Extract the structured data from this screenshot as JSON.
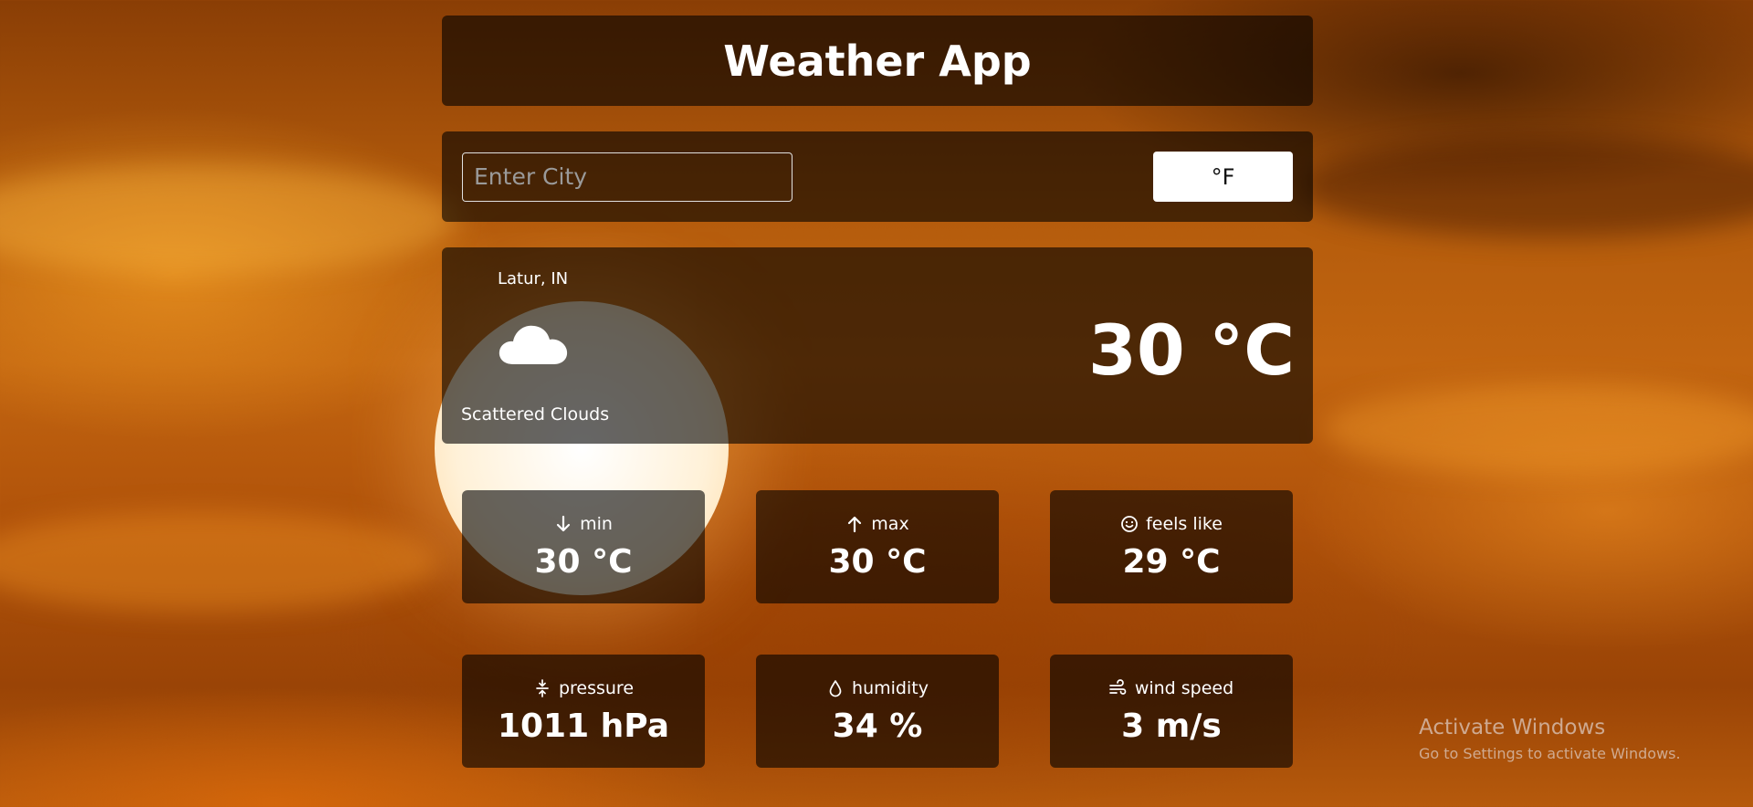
{
  "header": {
    "title": "Weather App"
  },
  "search": {
    "placeholder": "Enter City",
    "value": "",
    "unit_button_label": "°F"
  },
  "current": {
    "location": "Latur, IN",
    "icon": "cloud-icon",
    "description": "Scattered Clouds",
    "temperature": "30 °C"
  },
  "stats": [
    {
      "label": "min",
      "value": "30 °C",
      "icon": "arrow-down-icon"
    },
    {
      "label": "max",
      "value": "30 °C",
      "icon": "arrow-up-icon"
    },
    {
      "label": "feels like",
      "value": "29 °C",
      "icon": "smiley-icon"
    },
    {
      "label": "pressure",
      "value": "1011 hPa",
      "icon": "compress-icon"
    },
    {
      "label": "humidity",
      "value": "34 %",
      "icon": "droplet-icon"
    },
    {
      "label": "wind speed",
      "value": "3 m/s",
      "icon": "wind-icon"
    }
  ],
  "watermark": {
    "title": "Activate Windows",
    "subtitle": "Go to Settings to activate Windows."
  },
  "colors": {
    "panel_background": "#000000",
    "text": "#ffffff",
    "button_background": "#ffffff"
  }
}
